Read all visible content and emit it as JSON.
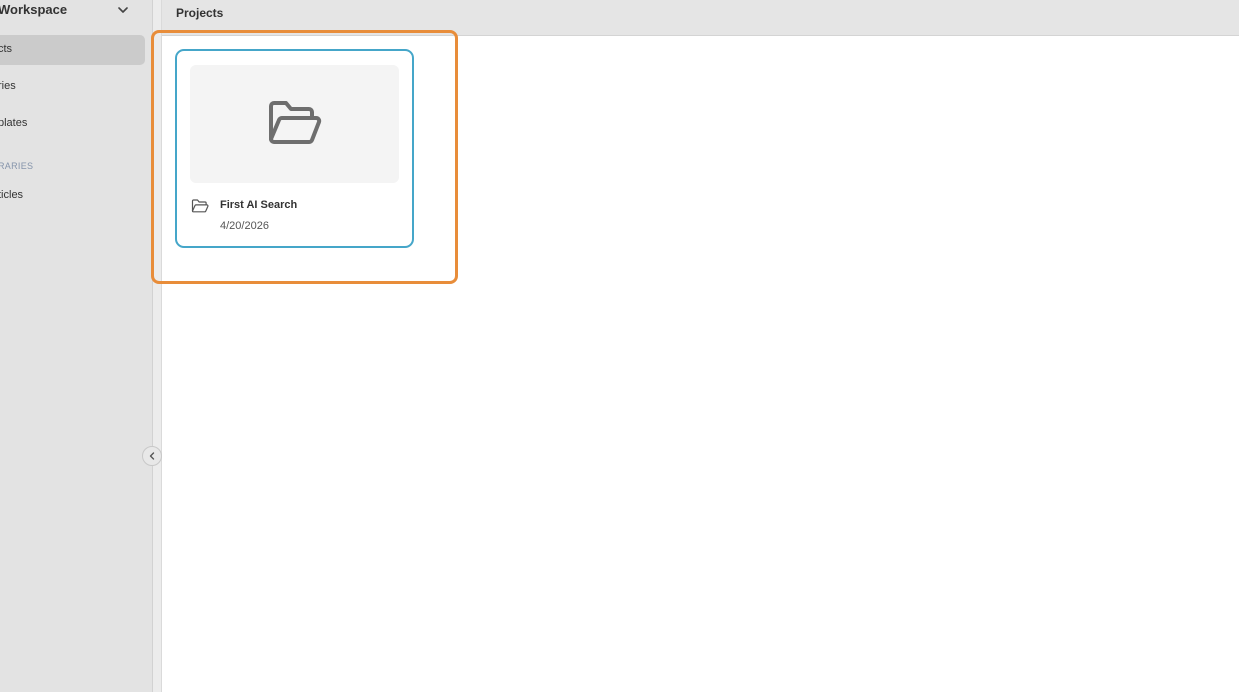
{
  "sidebar": {
    "workspace_name": "Workspace",
    "items": [
      {
        "label": "cts",
        "active": true
      },
      {
        "label": "ries",
        "active": false
      },
      {
        "label": "plates",
        "active": false
      }
    ],
    "section_label": "RARIES",
    "library_items": [
      {
        "label": "ticles"
      }
    ]
  },
  "header": {
    "title": "Projects"
  },
  "projects": [
    {
      "name": "First AI Search",
      "date": "4/20/2026",
      "icon": "folder-open-icon"
    }
  ],
  "colors": {
    "highlight": "#e88d3a",
    "card_border": "#45a6c9",
    "section_label": "#8594ab"
  }
}
